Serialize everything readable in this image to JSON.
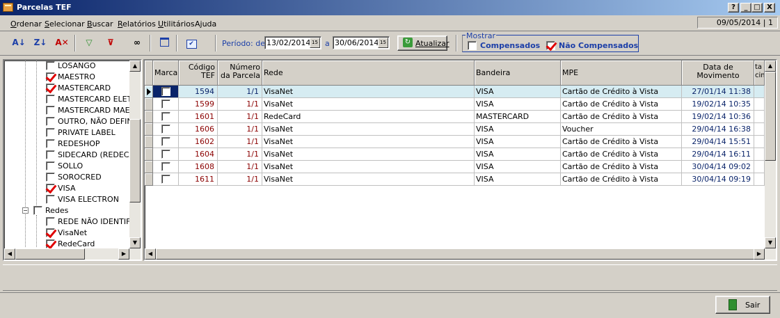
{
  "window": {
    "title": "Parcelas TEF"
  },
  "caption_buttons": [
    "?",
    "_",
    "□",
    "X"
  ],
  "menu": [
    {
      "label": "Ordenar",
      "key": "O",
      "rest": "rdenar"
    },
    {
      "label": "Selecionar",
      "key": "S",
      "rest": "elecionar"
    },
    {
      "label": "Buscar",
      "key": "B",
      "rest": "uscar"
    },
    {
      "label": "Relatórios",
      "key": "R",
      "rest": "elatórios"
    },
    {
      "label": "Utilitários",
      "key": "U",
      "rest": "tilitários"
    },
    {
      "label": "Ajuda",
      "key": "",
      "rest": "Ajuda"
    }
  ],
  "status_date": "09/05/2014 | 1",
  "toolbar": {
    "icons": [
      "sort-asc-icon",
      "sort-desc-icon",
      "sort-clear-icon",
      "filter-icon",
      "filter-clear-icon",
      "binoculars-icon",
      "window-icon",
      "checklist-icon"
    ],
    "periodo_label": "Período: de",
    "date_from": "13/02/2014",
    "a_label": "a",
    "date_to": "30/06/2014",
    "atualizar_label": "Atualizar",
    "mostrar_label": "Mostrar",
    "compensados_label": "Compensados",
    "compensados_checked": false,
    "nao_compensados_label": "Não Compensados",
    "nao_compensados_checked": true
  },
  "tree": {
    "items": [
      {
        "label": "LOSANGO",
        "checked": false,
        "level": 2
      },
      {
        "label": "MAESTRO",
        "checked": true,
        "level": 2
      },
      {
        "label": "MASTERCARD",
        "checked": true,
        "level": 2
      },
      {
        "label": "MASTERCARD ELET",
        "checked": false,
        "level": 2
      },
      {
        "label": "MASTERCARD MAES",
        "checked": false,
        "level": 2
      },
      {
        "label": "OUTRO, NÃO DEFIN",
        "checked": false,
        "level": 2
      },
      {
        "label": "PRIVATE LABEL",
        "checked": false,
        "level": 2
      },
      {
        "label": "REDESHOP",
        "checked": false,
        "level": 2
      },
      {
        "label": "SIDECARD (REDECA",
        "checked": false,
        "level": 2
      },
      {
        "label": "SOLLO",
        "checked": false,
        "level": 2
      },
      {
        "label": "SOROCRED",
        "checked": false,
        "level": 2
      },
      {
        "label": "VISA",
        "checked": true,
        "level": 2
      },
      {
        "label": "VISA ELECTRON",
        "checked": false,
        "level": 2
      },
      {
        "label": "Redes",
        "checked": false,
        "level": 1,
        "expander": "−"
      },
      {
        "label": "REDE NÃO IDENTIFI",
        "checked": false,
        "level": 2
      },
      {
        "label": "VisaNet",
        "checked": true,
        "level": 2
      },
      {
        "label": "RedeCard",
        "checked": true,
        "level": 2
      }
    ]
  },
  "grid": {
    "headers": [
      "Marcar",
      "Código TEF",
      "Número da Parcela",
      "Rede",
      "Bandeira",
      "MPE",
      "Data de Movimento",
      "ta cim"
    ],
    "rows": [
      {
        "codigo": "1594",
        "parcela": "1/1",
        "rede": "VisaNet",
        "bandeira": "VISA",
        "mpe": "Cartão de Crédito à Vista",
        "data": "27/01/14 11:38",
        "selected": true
      },
      {
        "codigo": "1599",
        "parcela": "1/1",
        "rede": "VisaNet",
        "bandeira": "VISA",
        "mpe": "Cartão de Crédito à Vista",
        "data": "19/02/14 10:35",
        "selected": false
      },
      {
        "codigo": "1601",
        "parcela": "1/1",
        "rede": "RedeCard",
        "bandeira": "MASTERCARD",
        "mpe": "Cartão de Crédito à Vista",
        "data": "19/02/14 10:36",
        "selected": false
      },
      {
        "codigo": "1606",
        "parcela": "1/1",
        "rede": "VisaNet",
        "bandeira": "VISA",
        "mpe": "Voucher",
        "data": "29/04/14 16:38",
        "selected": false
      },
      {
        "codigo": "1602",
        "parcela": "1/1",
        "rede": "VisaNet",
        "bandeira": "VISA",
        "mpe": "Cartão de Crédito à Vista",
        "data": "29/04/14 15:51",
        "selected": false
      },
      {
        "codigo": "1604",
        "parcela": "1/1",
        "rede": "VisaNet",
        "bandeira": "VISA",
        "mpe": "Cartão de Crédito à Vista",
        "data": "29/04/14 16:11",
        "selected": false
      },
      {
        "codigo": "1608",
        "parcela": "1/1",
        "rede": "VisaNet",
        "bandeira": "VISA",
        "mpe": "Cartão de Crédito à Vista",
        "data": "30/04/14 09:02",
        "selected": false
      },
      {
        "codigo": "1611",
        "parcela": "1/1",
        "rede": "VisaNet",
        "bandeira": "VISA",
        "mpe": "Cartão de Crédito à Vista",
        "data": "30/04/14 09:19",
        "selected": false
      }
    ]
  },
  "footer": {
    "sair_label": "Sair"
  },
  "colors": {
    "title_start": "#0a246a",
    "title_end": "#a6caf0",
    "label_blue": "#1c3fa8",
    "codigo_red": "#8b0000",
    "check_red": "#e00000",
    "row_selected": "#d6ecf2"
  }
}
